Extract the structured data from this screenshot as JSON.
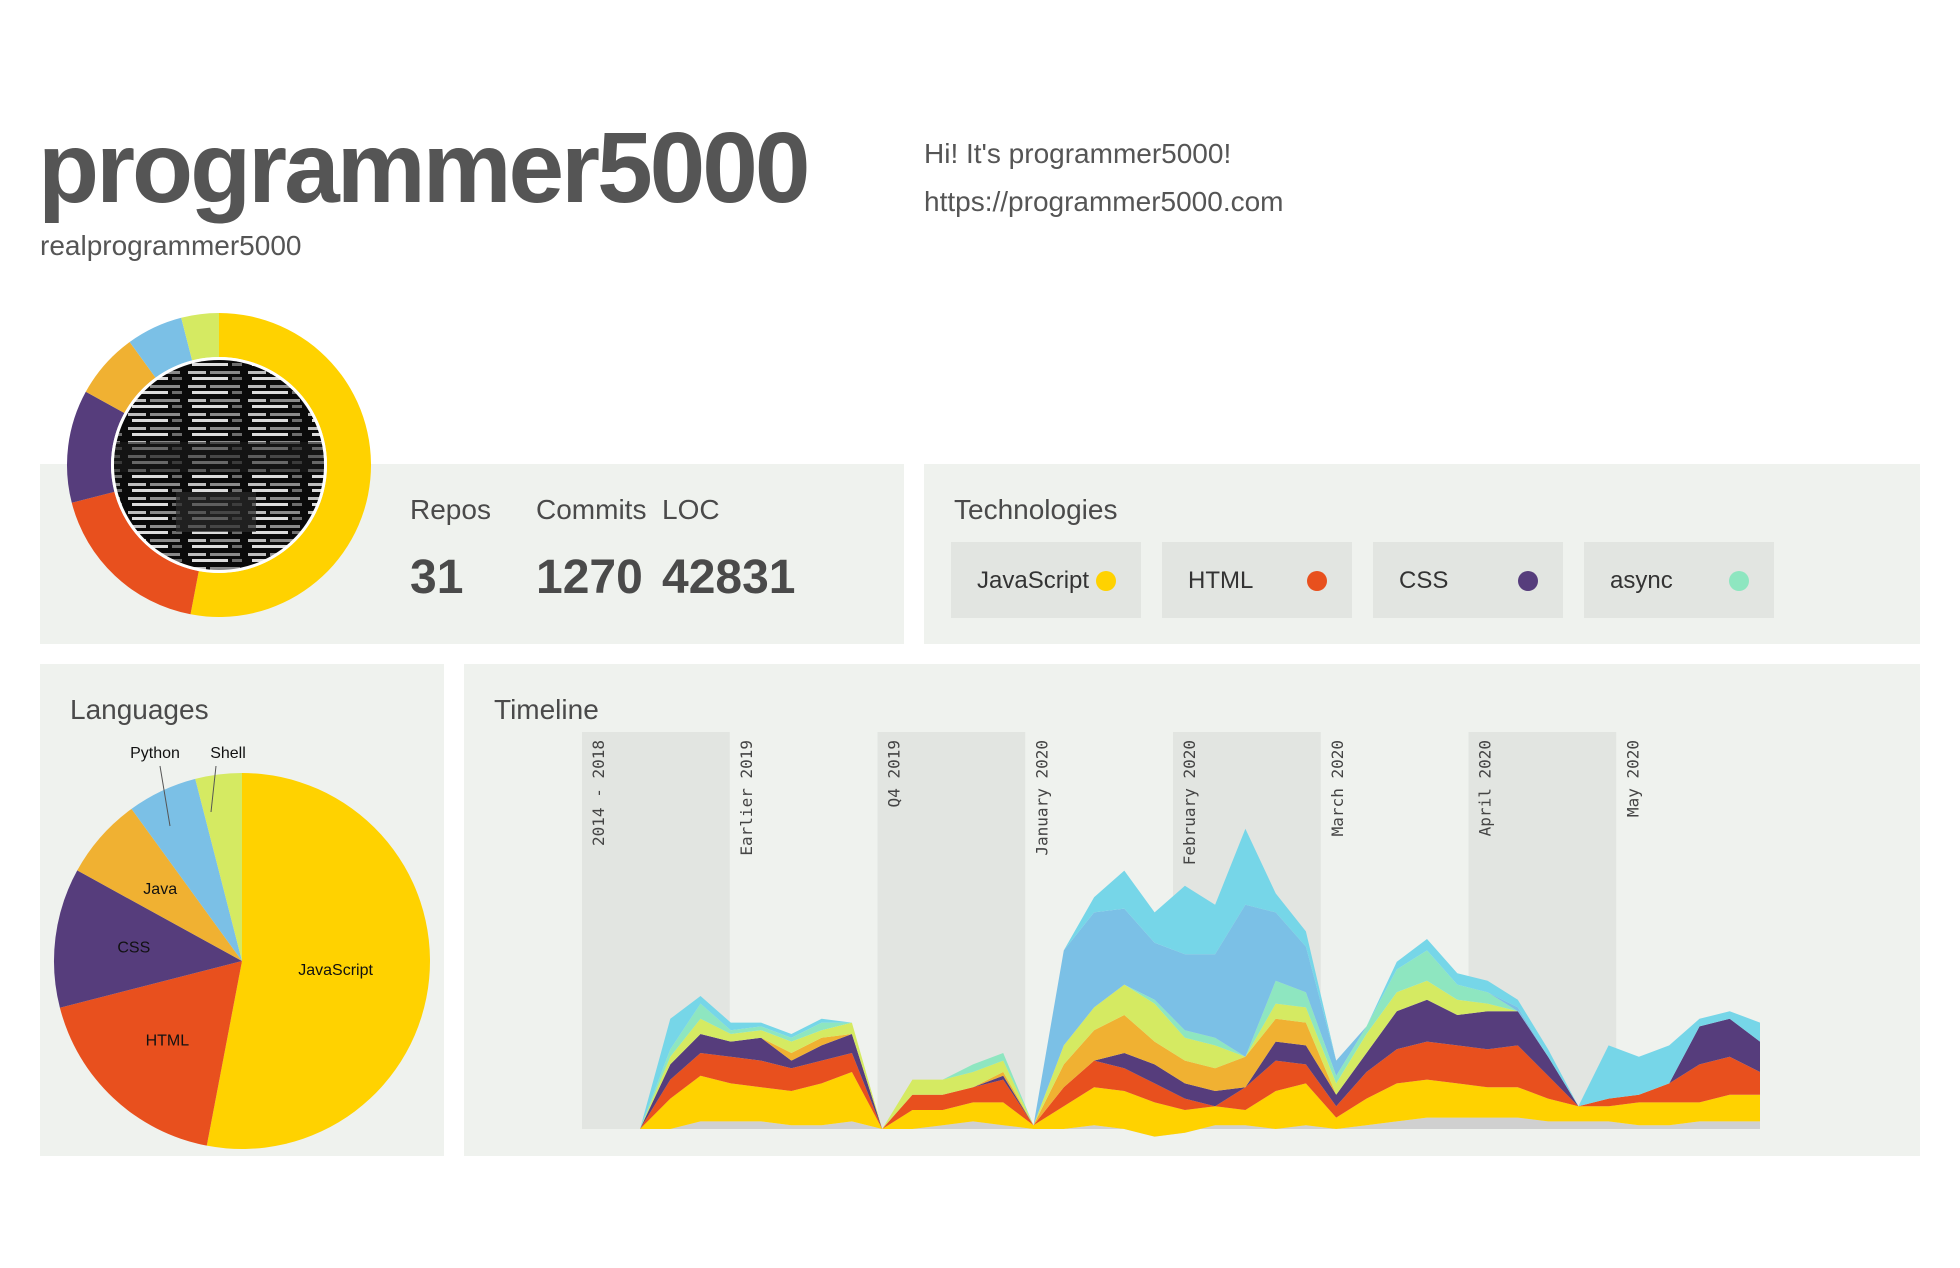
{
  "profile": {
    "name": "programmer5000",
    "handle": "realprogrammer5000",
    "bio": "Hi! It's programmer5000!",
    "website": "https://programmer5000.com"
  },
  "stats": [
    {
      "label": "Repos",
      "value": "31"
    },
    {
      "label": "Commits",
      "value": "1270"
    },
    {
      "label": "LOC",
      "value": "42831"
    }
  ],
  "technologies": {
    "title": "Technologies",
    "items": [
      {
        "label": "JavaScript",
        "color": "#ffd200"
      },
      {
        "label": "HTML",
        "color": "#e8501e"
      },
      {
        "label": "CSS",
        "color": "#563d7c"
      },
      {
        "label": "async",
        "color": "#8ee6c0"
      }
    ]
  },
  "languages": {
    "title": "Languages"
  },
  "timeline": {
    "title": "Timeline"
  },
  "colors": {
    "JavaScript": "#ffd200",
    "HTML": "#e8501e",
    "CSS": "#563d7c",
    "Java": "#f0b132",
    "Python": "#7bc0e6",
    "Shell": "#d5ea62",
    "Other": "#d0d0d0",
    "Cyan": "#76d6e8",
    "Panel": "#eff2ee",
    "Band": "#e2e5e1"
  },
  "chart_data": [
    {
      "type": "pie",
      "title": "Languages",
      "categories": [
        "JavaScript",
        "HTML",
        "CSS",
        "Java",
        "Python",
        "Shell"
      ],
      "values": [
        53,
        18,
        12,
        7,
        6,
        4
      ],
      "labels": [
        "JavaScript",
        "HTML",
        "CSS",
        "Java",
        "Python",
        "Shell"
      ]
    },
    {
      "type": "pie",
      "title": "",
      "categories": [
        "JavaScript",
        "HTML",
        "CSS",
        "Java",
        "Python",
        "Shell"
      ],
      "values": [
        53,
        18,
        12,
        7,
        6,
        4
      ]
    },
    {
      "type": "area",
      "title": "Timeline",
      "periods": [
        "2014 - 2018",
        "Earlier 2019",
        "Q4 2019",
        "January 2020",
        "February 2020",
        "March 2020",
        "April 2020",
        "May 2020"
      ],
      "series": [
        {
          "name": "",
          "color": "#d0d0d0",
          "values": [
            0,
            0,
            2,
            2,
            2,
            1,
            1,
            2,
            0,
            0,
            1,
            2,
            1,
            0,
            0,
            1,
            0,
            -2,
            -1,
            1,
            1,
            0,
            1,
            0,
            1,
            2,
            3,
            3,
            3,
            3,
            2,
            2,
            2,
            1,
            1,
            2,
            2,
            2
          ]
        },
        {
          "name": "",
          "color": "#ffd200",
          "values": [
            0,
            8,
            12,
            10,
            9,
            9,
            11,
            13,
            0,
            5,
            4,
            5,
            6,
            1,
            6,
            10,
            10,
            9,
            6,
            5,
            4,
            10,
            11,
            3,
            7,
            10,
            10,
            9,
            8,
            8,
            6,
            4,
            4,
            6,
            6,
            5,
            7,
            7
          ]
        },
        {
          "name": "",
          "color": "#e8501e",
          "values": [
            0,
            5,
            6,
            7,
            7,
            6,
            6,
            5,
            0,
            4,
            4,
            4,
            6,
            0,
            5,
            7,
            6,
            5,
            3,
            0,
            6,
            8,
            5,
            3,
            7,
            9,
            10,
            10,
            10,
            11,
            6,
            0,
            2,
            2,
            5,
            10,
            10,
            6
          ]
        },
        {
          "name": "",
          "color": "#563d7c",
          "values": [
            0,
            4,
            5,
            4,
            6,
            2,
            4,
            5,
            0,
            0,
            0,
            0,
            1,
            0,
            0,
            0,
            4,
            5,
            4,
            4,
            0,
            5,
            5,
            3,
            5,
            10,
            11,
            8,
            10,
            9,
            5,
            0,
            0,
            0,
            0,
            10,
            10,
            8
          ]
        },
        {
          "name": "",
          "color": "#f0b132",
          "values": [
            0,
            0,
            0,
            0,
            0,
            2,
            2,
            0,
            0,
            0,
            0,
            0,
            1,
            0,
            6,
            8,
            10,
            6,
            6,
            6,
            8,
            6,
            6,
            0,
            0,
            0,
            0,
            0,
            0,
            0,
            0,
            0,
            0,
            0,
            0,
            0,
            0,
            0
          ]
        },
        {
          "name": "",
          "color": "#d5ea62",
          "values": [
            0,
            2,
            4,
            2,
            2,
            3,
            2,
            3,
            0,
            4,
            4,
            4,
            3,
            0,
            5,
            6,
            8,
            10,
            6,
            6,
            0,
            4,
            4,
            3,
            5,
            5,
            5,
            4,
            2,
            0,
            0,
            0,
            0,
            0,
            0,
            0,
            0,
            0
          ]
        },
        {
          "name": "",
          "color": "#8ee6c0",
          "values": [
            0,
            2,
            4,
            1,
            1,
            1,
            2,
            0,
            0,
            0,
            0,
            2,
            2,
            0,
            0,
            0,
            0,
            1,
            2,
            2,
            0,
            6,
            4,
            2,
            2,
            6,
            8,
            4,
            3,
            0,
            0,
            0,
            0,
            0,
            0,
            0,
            0,
            0
          ]
        },
        {
          "name": "",
          "color": "#7bc0e6",
          "values": [
            0,
            0,
            0,
            0,
            0,
            0,
            0,
            0,
            0,
            0,
            0,
            0,
            0,
            0,
            25,
            25,
            20,
            15,
            20,
            22,
            40,
            18,
            12,
            4,
            0,
            0,
            0,
            0,
            0,
            1,
            0,
            0,
            0,
            0,
            0,
            0,
            0,
            0
          ]
        },
        {
          "name": "",
          "color": "#76d6e8",
          "values": [
            0,
            8,
            2,
            2,
            1,
            1,
            1,
            0,
            0,
            0,
            0,
            0,
            0,
            0,
            0,
            4,
            10,
            8,
            18,
            13,
            20,
            5,
            4,
            0,
            0,
            2,
            3,
            3,
            3,
            2,
            2,
            0,
            14,
            10,
            10,
            2,
            2,
            5
          ]
        }
      ]
    }
  ]
}
